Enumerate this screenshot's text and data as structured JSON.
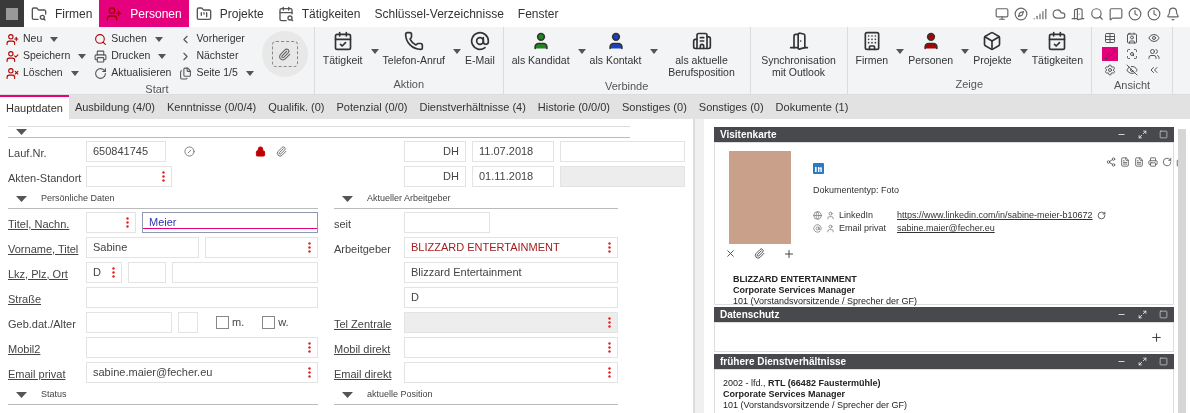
{
  "app_bar": {
    "items": [
      {
        "label": "Firmen",
        "selected": false
      },
      {
        "label": "Personen",
        "selected": true
      },
      {
        "label": "Projekte",
        "selected": false
      },
      {
        "label": "Tätigkeiten",
        "selected": false
      },
      {
        "label": "Schlüssel-Verzeichnisse",
        "selected": false
      },
      {
        "label": "Fenster",
        "selected": false
      }
    ]
  },
  "ribbon": {
    "groups": [
      {
        "kind": "start",
        "label": "Start",
        "columns": [
          [
            {
              "label": "Neu",
              "dropdown": true
            },
            {
              "label": "Speichern",
              "dropdown": true
            },
            {
              "label": "Löschen",
              "dropdown": true
            }
          ],
          [
            {
              "label": "Suchen",
              "dropdown": true
            },
            {
              "label": "Drucken",
              "dropdown": true
            },
            {
              "label": "Aktualisieren",
              "dropdown": false
            }
          ],
          [
            {
              "label": "Vorheriger",
              "dropdown": false
            },
            {
              "label": "Nächster",
              "dropdown": false
            },
            {
              "label": "Seite 1/5",
              "dropdown": true
            }
          ]
        ]
      },
      {
        "kind": "buttons",
        "label": "Aktion",
        "buttons": [
          {
            "label": "Tätigkeit",
            "dropdown": true
          },
          {
            "label": "Telefon-Anruf",
            "dropdown": true
          },
          {
            "label": "E-Mail",
            "dropdown": false
          }
        ]
      },
      {
        "kind": "buttons",
        "label": "Verbinde",
        "buttons": [
          {
            "label": "als Kandidat",
            "dropdown": true
          },
          {
            "label": "als Kontakt",
            "dropdown": true
          },
          {
            "label": "als aktuelle Berufsposition",
            "dropdown": false
          }
        ]
      },
      {
        "kind": "buttons",
        "buttons": [
          {
            "label": "Synchronisation mit Outlook",
            "dropdown": false
          }
        ]
      },
      {
        "kind": "buttons",
        "label": "Zeige",
        "buttons": [
          {
            "label": "Firmen",
            "dropdown": true
          },
          {
            "label": "Personen",
            "dropdown": true
          },
          {
            "label": "Projekte",
            "dropdown": true
          },
          {
            "label": "Tätigkeiten",
            "dropdown": false
          }
        ]
      },
      {
        "kind": "view",
        "label": "Ansicht",
        "items": [
          {
            "selected": false
          },
          {
            "selected": false
          },
          {
            "selected": false
          },
          {
            "selected": true
          },
          {
            "selected": false
          },
          {
            "selected": false
          },
          {
            "selected": false
          },
          {
            "selected": false
          },
          {
            "selected": false
          }
        ]
      }
    ]
  },
  "tabs": [
    {
      "label": "Hauptdaten",
      "selected": true
    },
    {
      "label": "Ausbildung (4/0)",
      "selected": false
    },
    {
      "label": "Kenntnisse (0/0/4)",
      "selected": false
    },
    {
      "label": "Qualifik. (0)",
      "selected": false
    },
    {
      "label": "Potenzial (0/0)",
      "selected": false
    },
    {
      "label": "Dienstverhältnisse (4)",
      "selected": false
    },
    {
      "label": "Historie (0/0/0)",
      "selected": false
    },
    {
      "label": "Sonstiges (0)",
      "selected": false
    },
    {
      "label": "Sonstiges (0)",
      "selected": false
    },
    {
      "label": "Dokumente (1)",
      "selected": false
    }
  ],
  "form": {
    "sections": [
      {
        "left": {
          "rows": [
            {
              "kind": "number",
              "label": "Lauf.Nr.",
              "link": false,
              "inputs": [
                {
                  "value": "650841745",
                  "lookup": false
                }
              ]
            },
            {
              "kind": "short",
              "label": "Akten-Standort",
              "link": false,
              "inputs": [
                {
                  "lookup": true
                }
              ]
            }
          ]
        },
        "right": {
          "rows": [
            {
              "kind": "stamp",
              "inputs": [
                {
                  "value": "DH",
                  "lookup": false
                },
                {
                  "value": "11.07.2018",
                  "lookup": false
                },
                {
                  "lookup": false,
                  "disabled": false
                }
              ]
            },
            {
              "kind": "stamp",
              "inputs": [
                {
                  "value": "DH",
                  "lookup": false
                },
                {
                  "value": "01.11.2018",
                  "lookup": false
                },
                {
                  "lookup": false,
                  "disabled": true
                }
              ]
            }
          ]
        }
      },
      {
        "left": {
          "title": "Persönliche Daten",
          "rows": [
            {
              "kind": "name",
              "label": "Titel, Nachn.",
              "link": true,
              "inputs": [
                {
                  "lookup": true
                },
                {
                  "value": "Meier",
                  "lookup": false,
                  "focused": true
                }
              ]
            },
            {
              "kind": "pair",
              "label": "Vorname, Titel",
              "link": true,
              "inputs": [
                {
                  "value": "Sabine",
                  "lookup": false
                },
                {
                  "lookup": true
                }
              ]
            },
            {
              "kind": "address",
              "label": "Lkz, Plz, Ort",
              "link": true,
              "inputs": [
                {
                  "value": "D",
                  "lookup": true
                },
                {
                  "lookup": false
                },
                {
                  "lookup": false
                }
              ]
            },
            {
              "kind": "single",
              "label": "Straße",
              "link": true,
              "inputs": [
                {
                  "lookup": false
                }
              ]
            },
            {
              "kind": "birth",
              "label": "Geb.dat./Alter",
              "link": false,
              "inputs": [
                {
                  "lookup": false
                },
                {
                  "lookup": false
                }
              ],
              "checks": [
                {
                  "label": "m.",
                  "checked": false
                },
                {
                  "label": "w.",
                  "checked": false
                }
              ]
            },
            {
              "kind": "single",
              "label": "Mobil2",
              "link": true,
              "inputs": [
                {
                  "lookup": true
                }
              ]
            },
            {
              "kind": "single",
              "label": "Email privat",
              "link": true,
              "inputs": [
                {
                  "value": "sabine.maier@fecher.eu",
                  "lookup": true
                }
              ]
            }
          ]
        },
        "right": {
          "title": "Aktueller Arbeitgeber",
          "rows": [
            {
              "kind": "short",
              "label": "seit",
              "link": false,
              "inputs": [
                {
                  "lookup": false
                }
              ]
            },
            {
              "kind": "single",
              "label": "Arbeitgeber",
              "link": false,
              "inputs": [
                {
                  "value": "BLIZZARD ENTERTAINMENT",
                  "lookup": true,
                  "linked": true
                }
              ]
            },
            {
              "kind": "single",
              "inputs": [
                {
                  "value": "Blizzard Entertainment",
                  "lookup": false
                }
              ]
            },
            {
              "kind": "single",
              "inputs": [
                {
                  "value": "D",
                  "lookup": false
                }
              ]
            },
            {
              "kind": "single",
              "label": "Tel Zentrale",
              "link": true,
              "inputs": [
                {
                  "lookup": true,
                  "disabled": true
                }
              ]
            },
            {
              "kind": "single",
              "label": "Mobil direkt",
              "link": true,
              "inputs": [
                {
                  "lookup": true
                }
              ]
            },
            {
              "kind": "single",
              "label": "Email direkt",
              "link": true,
              "inputs": [
                {
                  "lookup": true
                }
              ]
            }
          ]
        }
      },
      {
        "left": {
          "title": "Status"
        },
        "right": {
          "title": "aktuelle Position"
        }
      }
    ]
  },
  "panels": {
    "card": {
      "title": "Visitenkarte",
      "document_type": "Dokumententyp: Foto",
      "contacts": [
        {
          "label": "LinkedIn",
          "value": "https://www.linkedin.com/in/sabine-meier-b10672"
        },
        {
          "label": "Email privat",
          "value": "sabine.maier@fecher.eu"
        }
      ],
      "company": "BLIZZARD ENTERTAINMENT",
      "position": "Corporate Services Manager",
      "code": "101 (Vorstandsvorsitzende / Sprecher der GF)"
    },
    "privacy": {
      "title": "Datenschutz"
    },
    "history": {
      "title": "frühere Dienstverhältnisse",
      "entries": [
        {
          "period": "2002 - lfd., **RTL (66482 Faustermühle)**",
          "position": "Corporate Services Manager",
          "code": "101 (Vorstandsvorsitzende / Sprecher der GF)"
        }
      ]
    }
  }
}
